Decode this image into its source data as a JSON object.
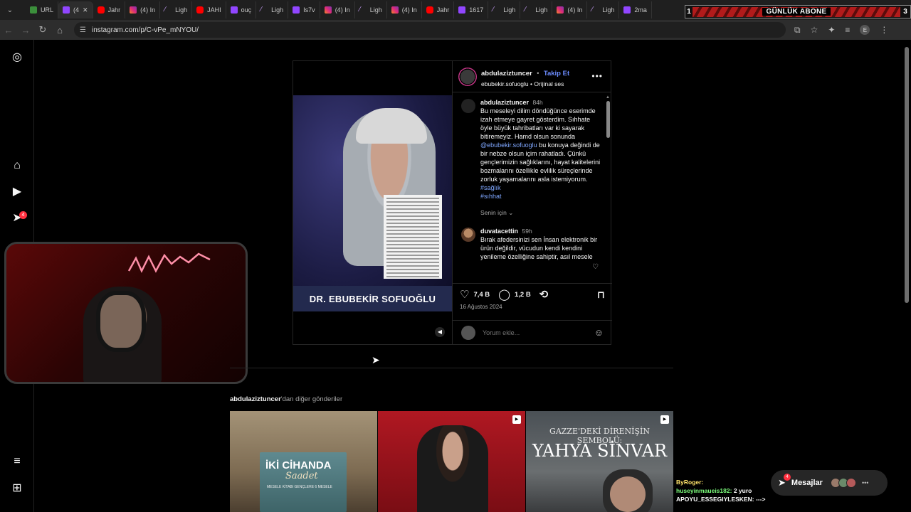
{
  "browser": {
    "tabs": [
      {
        "label": "URL",
        "type": "url"
      },
      {
        "label": "(4",
        "type": "tw",
        "active": true
      },
      {
        "label": "Jahr",
        "type": "yt"
      },
      {
        "label": "(4) In",
        "type": "ig"
      },
      {
        "label": "Ligh",
        "type": "lt"
      },
      {
        "label": "JAHI",
        "type": "yt"
      },
      {
        "label": "ouç",
        "type": "tw"
      },
      {
        "label": "Ligh",
        "type": "lt"
      },
      {
        "label": "Is7v",
        "type": "tw"
      },
      {
        "label": "(4) In",
        "type": "ig"
      },
      {
        "label": "Ligh",
        "type": "lt"
      },
      {
        "label": "(4) In",
        "type": "ig"
      },
      {
        "label": "Jahr",
        "type": "yt"
      },
      {
        "label": "1617",
        "type": "tw"
      },
      {
        "label": "Ligh",
        "type": "lt"
      },
      {
        "label": "Ligh",
        "type": "lt"
      },
      {
        "label": "(4) In",
        "type": "ig"
      },
      {
        "label": "Ligh",
        "type": "lt"
      },
      {
        "label": "2ma",
        "type": "tw"
      }
    ],
    "url": "instagram.com/p/C-vPe_mNYOU/",
    "banner": {
      "left_num": "1",
      "text": "GÜNLÜK ABONE",
      "right_num": "3"
    }
  },
  "post": {
    "username": "abdulaziztuncer",
    "follow_label": "Takip Et",
    "audio_user": "ebubekir.sofuoglu",
    "audio_label": "Orijinal ses",
    "video_caption": "DR. EBUBEKİR SOFUOĞLU",
    "caption": {
      "user": "abdulaziztuncer",
      "time": "84h",
      "text_before": "Bu meseleyi dilim döndüğünce eserimde izah etmeye gayret gösterdim. Sıhhate öyle büyük tahribatları var ki sayarak bitiremeyiz. Hamd olsun sonunda",
      "mention": "@ebubekir.sofuoglu",
      "text_after": "bu konuya değindi de bir nebze olsun içim rahatladı. Çünkü gençlerimizin sağlıklarını, hayat kalitelerini bozmalarını özellikle evlilik süreçlerinde zorluk yaşamalarını asla istemiyorum.",
      "tag1": "#sağlık",
      "tag2": "#sıhhat"
    },
    "for_you": "Senin için",
    "comment": {
      "user": "duvatacettin",
      "time": "59h",
      "text": "Bırak afedersinizi sen İnsan elektronik bir ürün değildir, vücudun kendi kendini yenileme özelliğine sahiptir, asıl mesele"
    },
    "likes": "7,4 B",
    "comments": "1,2 B",
    "date": "16 Ağustos 2024",
    "comment_placeholder": "Yorum ekle..."
  },
  "more_posts": {
    "user": "abdulaziztuncer",
    "suffix": "'dan diğer gönderiler",
    "post1": {
      "title": "İKİ CİHANDA",
      "script": "Saadet",
      "subtitle": "MESELE KİTABI GENÇLERE 6 MESELE"
    },
    "post3": {
      "line1": "GAZZE'DEKİ DİRENİŞİN SEMBOLÜ:",
      "line2": "YAHYA SİNVAR"
    }
  },
  "notifications_badge": "4",
  "messages": {
    "label": "Mesajlar",
    "badge": "4"
  },
  "chat": [
    {
      "user": "ByRoger:",
      "msg": "",
      "color": "#ffe36b"
    },
    {
      "user": "huseyinmaueis182:",
      "msg": "2 yuro",
      "color": "#7dff7d"
    },
    {
      "user": "APOYU_ESSEGIYLESKEN:",
      "msg": "--->",
      "color": "#ffffff"
    }
  ]
}
